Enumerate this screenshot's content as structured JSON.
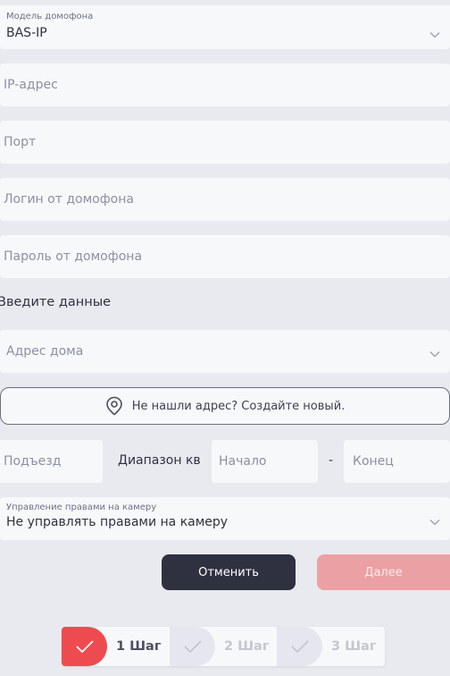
{
  "intercom_model": {
    "label": "Модель домофона",
    "value": "BAS-IP"
  },
  "ip_field": {
    "placeholder": "IP-адрес"
  },
  "port_field": {
    "placeholder": "Порт"
  },
  "login_field": {
    "placeholder": "Логин от домофона"
  },
  "password_field": {
    "placeholder": "Пароль от домофона"
  },
  "section_title": "Введите данные",
  "address_field": {
    "placeholder": "Адрес дома"
  },
  "create_address": {
    "label": "Не нашли адрес? Создайте новый."
  },
  "entrance_field": {
    "placeholder": "Подъезд"
  },
  "range": {
    "label": "Диапазон кв",
    "start_placeholder": "Начало",
    "dash": "-",
    "end_placeholder": "Конец"
  },
  "camera_rights": {
    "label": "Управление правами на камеру",
    "value": "Не управлять правами на камеру"
  },
  "buttons": {
    "cancel": "Отменить",
    "next": "Далее"
  },
  "steps": [
    {
      "label": "1 Шаг",
      "active": true
    },
    {
      "label": "2 Шаг",
      "active": false
    },
    {
      "label": "3 Шаг",
      "active": false
    }
  ],
  "colors": {
    "accent": "#ee4b50",
    "dark": "#2f3140",
    "disabled_next": "#eba1a3",
    "background": "#e9eaf0"
  }
}
